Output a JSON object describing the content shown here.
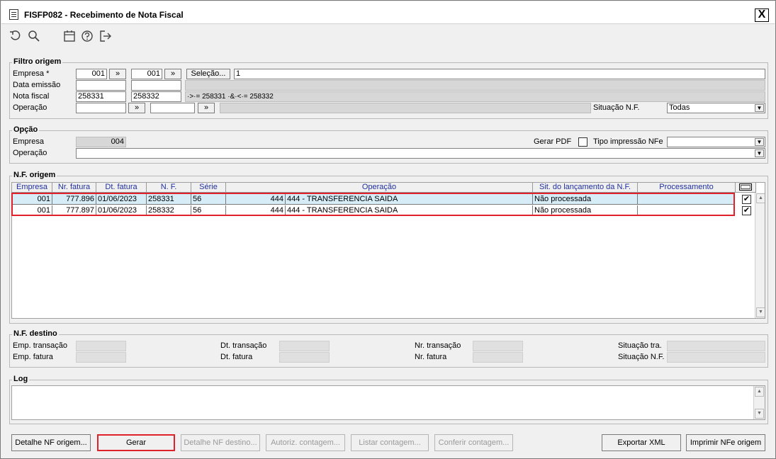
{
  "window": {
    "title": "FISFP082 - Recebimento de Nota Fiscal",
    "close_label": "X"
  },
  "toolbar": {
    "icons": [
      "undo-icon",
      "search-icon",
      "calendar-icon",
      "help-icon",
      "exit-icon"
    ]
  },
  "filtro": {
    "title": "Filtro origem",
    "empresa_label": "Empresa *",
    "empresa_from": "001",
    "empresa_to": "001",
    "arrow": "»",
    "selecao_label": "Seleção...",
    "selecao_value": "1",
    "data_emissao_label": "Data emissão",
    "nota_fiscal_label": "Nota fiscal",
    "nf_from": "258331",
    "nf_to": "258332",
    "nf_expr": "·>·= 258331 ·&·<·= 258332",
    "operacao_label": "Operação",
    "situacao_label": "Situação N.F.",
    "situacao_value": "Todas",
    "dd": "▼"
  },
  "opcao": {
    "title": "Opção",
    "empresa_label": "Empresa",
    "empresa_value": "004",
    "gerar_pdf_label": "Gerar PDF",
    "tipo_label": "Tipo impressão NFe",
    "operacao_label": "Operação"
  },
  "nf_origem": {
    "title": "N.F. origem",
    "columns": [
      "Empresa",
      "Nr. fatura",
      "Dt. fatura",
      "N. F.",
      "Série",
      "Operação",
      "Sit. do lançamento da N.F.",
      "Processamento"
    ],
    "rows": [
      {
        "empresa": "001",
        "nr_fatura": "777.896",
        "dt_fatura": "01/06/2023",
        "nf": "258331",
        "serie": "56",
        "op_code": "444",
        "op_desc": "444 - TRANSFERENCIA SAIDA",
        "situacao": "Não processada",
        "processamento": "",
        "check": "✔"
      },
      {
        "empresa": "001",
        "nr_fatura": "777.897",
        "dt_fatura": "01/06/2023",
        "nf": "258332",
        "serie": "56",
        "op_code": "444",
        "op_desc": "444 - TRANSFERENCIA SAIDA",
        "situacao": "Não processada",
        "processamento": "",
        "check": "✔"
      }
    ],
    "scroll_up": "▲",
    "scroll_down": "▼"
  },
  "nf_destino": {
    "title": "N.F. destino",
    "emp_transacao_label": "Emp. transação",
    "emp_fatura_label": "Emp. fatura",
    "dt_transacao_label": "Dt. transação",
    "dt_fatura_label": "Dt. fatura",
    "nr_transacao_label": "Nr. transação",
    "nr_fatura_label": "Nr. fatura",
    "situacao_tra_label": "Situação tra.",
    "situacao_nf_label": "Situação N.F."
  },
  "log": {
    "title": "Log"
  },
  "buttons": {
    "detalhe_origem": "Detalhe NF origem...",
    "gerar": "Gerar",
    "detalhe_destino": "Detalhe NF destino...",
    "autoriz": "Autoriz. contagem...",
    "listar": "Listar contagem...",
    "conferir": "Conferir contagem...",
    "exportar": "Exportar XML",
    "imprimir": "Imprimir NFe origem"
  }
}
